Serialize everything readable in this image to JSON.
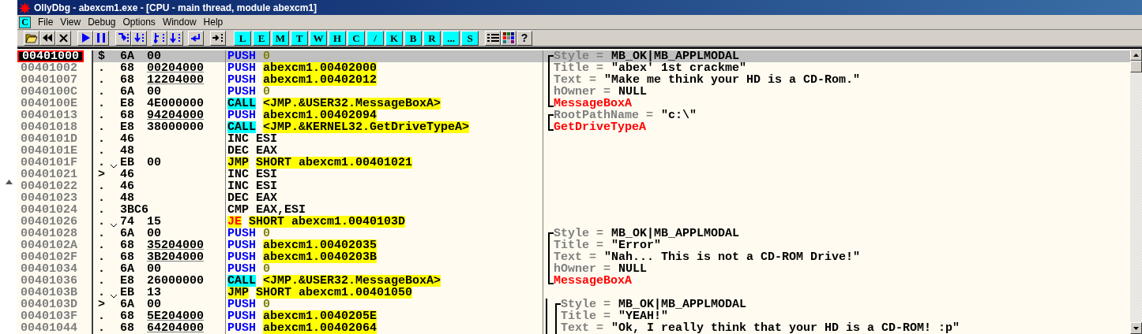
{
  "window": {
    "title": "OllyDbg - abexcm1.exe - [CPU - main thread, module abexcm1]"
  },
  "menu": {
    "badge": "C",
    "items": [
      "File",
      "View",
      "Debug",
      "Options",
      "Window",
      "Help"
    ]
  },
  "toolbar": {
    "icon_buttons": [
      {
        "kind": "open"
      },
      {
        "kind": "restart"
      },
      {
        "kind": "close"
      },
      {
        "kind": "run"
      },
      {
        "kind": "pause"
      },
      {
        "kind": "step_into"
      },
      {
        "kind": "step_over"
      },
      {
        "kind": "trace_into"
      },
      {
        "kind": "trace_over"
      },
      {
        "kind": "till_return"
      },
      {
        "kind": "goto"
      }
    ],
    "letter_buttons": [
      "L",
      "E",
      "M",
      "T",
      "W",
      "H",
      "C",
      "/",
      "K",
      "B",
      "R",
      "...",
      "S"
    ],
    "end_buttons": [
      {
        "kind": "list"
      },
      {
        "kind": "colors"
      },
      {
        "kind": "text",
        "text": "?"
      }
    ]
  },
  "disassembly": {
    "rows": [
      {
        "address": "00401000",
        "selected": true,
        "marker": "$",
        "jump": false,
        "opcode": "6A",
        "operand_bytes": "00",
        "fixup": false,
        "instruction": [
          {
            "kind": "push",
            "text": "PUSH"
          },
          {
            "kind": "const",
            "text": "0"
          }
        ],
        "comment": {
          "kind": "param",
          "bracket_top": true,
          "bracket_bottom": false,
          "nested": false,
          "name": "Style =",
          "value": "MB_OK|MB_APPLMODAL"
        }
      },
      {
        "address": "00401002",
        "selected": false,
        "marker": ".",
        "jump": false,
        "opcode": "68",
        "operand_bytes": "00204000",
        "fixup": true,
        "instruction": [
          {
            "kind": "push",
            "text": "PUSH"
          },
          {
            "kind": "highlight",
            "text": "abexcm1.00402000"
          }
        ],
        "comment": {
          "kind": "param",
          "bracket_top": false,
          "bracket_bottom": false,
          "nested": false,
          "name": "Title =",
          "value": "\"abex' 1st crackme\""
        }
      },
      {
        "address": "00401007",
        "selected": false,
        "marker": ".",
        "jump": false,
        "opcode": "68",
        "operand_bytes": "12204000",
        "fixup": true,
        "instruction": [
          {
            "kind": "push",
            "text": "PUSH"
          },
          {
            "kind": "highlight",
            "text": "abexcm1.00402012"
          }
        ],
        "comment": {
          "kind": "param",
          "bracket_top": false,
          "bracket_bottom": false,
          "nested": false,
          "name": "Text =",
          "value": "\"Make me think your HD is a CD-Rom.\""
        }
      },
      {
        "address": "0040100C",
        "selected": false,
        "marker": ".",
        "jump": false,
        "opcode": "6A",
        "operand_bytes": "00",
        "fixup": false,
        "instruction": [
          {
            "kind": "push",
            "text": "PUSH"
          },
          {
            "kind": "const",
            "text": "0"
          }
        ],
        "comment": {
          "kind": "param",
          "bracket_top": false,
          "bracket_bottom": false,
          "nested": false,
          "name": "hOwner =",
          "value": "NULL"
        }
      },
      {
        "address": "0040100E",
        "selected": false,
        "marker": ".",
        "jump": false,
        "opcode": "E8",
        "operand_bytes": "4E000000",
        "fixup": false,
        "instruction": [
          {
            "kind": "call",
            "text": "CALL"
          },
          {
            "kind": "highlight",
            "text": "<JMP.&USER32.MessageBoxA>"
          }
        ],
        "comment": {
          "kind": "function",
          "bracket_top": false,
          "bracket_bottom": true,
          "nested": false,
          "name": "MessageBoxA"
        }
      },
      {
        "address": "00401013",
        "selected": false,
        "marker": ".",
        "jump": false,
        "opcode": "68",
        "operand_bytes": "94204000",
        "fixup": true,
        "instruction": [
          {
            "kind": "push",
            "text": "PUSH"
          },
          {
            "kind": "highlight",
            "text": "abexcm1.00402094"
          }
        ],
        "comment": {
          "kind": "param",
          "bracket_top": true,
          "bracket_bottom": false,
          "nested": false,
          "name": "RootPathName =",
          "value": "\"c:\\\""
        }
      },
      {
        "address": "00401018",
        "selected": false,
        "marker": ".",
        "jump": false,
        "opcode": "E8",
        "operand_bytes": "38000000",
        "fixup": false,
        "instruction": [
          {
            "kind": "call",
            "text": "CALL"
          },
          {
            "kind": "highlight",
            "text": "<JMP.&KERNEL32.GetDriveTypeA>"
          }
        ],
        "comment": {
          "kind": "function",
          "bracket_top": false,
          "bracket_bottom": true,
          "nested": false,
          "name": "GetDriveTypeA"
        }
      },
      {
        "address": "0040101D",
        "selected": false,
        "marker": ".",
        "jump": false,
        "opcode": "46",
        "instruction": [
          {
            "kind": "plain",
            "text": "INC"
          },
          {
            "kind": "plain",
            "text": "ESI"
          }
        ]
      },
      {
        "address": "0040101E",
        "selected": false,
        "marker": ".",
        "jump": false,
        "opcode": "48",
        "instruction": [
          {
            "kind": "plain",
            "text": "DEC"
          },
          {
            "kind": "plain",
            "text": "EAX"
          }
        ]
      },
      {
        "address": "0040101F",
        "selected": false,
        "marker": ".",
        "jump": true,
        "opcode": "EB",
        "operand_bytes": "00",
        "fixup": false,
        "instruction": [
          {
            "kind": "jmp",
            "text": "JMP"
          },
          {
            "kind": "highlight",
            "text": "SHORT abexcm1.00401021"
          }
        ]
      },
      {
        "address": "00401021",
        "selected": false,
        "marker": ">",
        "jump": false,
        "opcode": "46",
        "instruction": [
          {
            "kind": "plain",
            "text": "INC"
          },
          {
            "kind": "plain",
            "text": "ESI"
          }
        ]
      },
      {
        "address": "00401022",
        "selected": false,
        "marker": ".",
        "jump": false,
        "opcode": "46",
        "instruction": [
          {
            "kind": "plain",
            "text": "INC"
          },
          {
            "kind": "plain",
            "text": "ESI"
          }
        ]
      },
      {
        "address": "00401023",
        "selected": false,
        "marker": ".",
        "jump": false,
        "opcode": "48",
        "instruction": [
          {
            "kind": "plain",
            "text": "DEC"
          },
          {
            "kind": "plain",
            "text": "EAX"
          }
        ]
      },
      {
        "address": "00401024",
        "selected": false,
        "marker": ".",
        "jump": false,
        "opcode": "3BC6",
        "instruction": [
          {
            "kind": "plain",
            "text": "CMP"
          },
          {
            "kind": "plain",
            "text": "EAX,ESI"
          }
        ]
      },
      {
        "address": "00401026",
        "selected": false,
        "marker": ".",
        "jump": true,
        "opcode": "74",
        "operand_bytes": "15",
        "fixup": false,
        "instruction": [
          {
            "kind": "jcc",
            "text": "JE"
          },
          {
            "kind": "highlight",
            "text": "SHORT abexcm1.0040103D"
          }
        ]
      },
      {
        "address": "00401028",
        "selected": false,
        "marker": ".",
        "jump": false,
        "opcode": "6A",
        "operand_bytes": "00",
        "fixup": false,
        "instruction": [
          {
            "kind": "push",
            "text": "PUSH"
          },
          {
            "kind": "const",
            "text": "0"
          }
        ],
        "comment": {
          "kind": "param",
          "bracket_top": true,
          "bracket_bottom": false,
          "nested": false,
          "name": "Style =",
          "value": "MB_OK|MB_APPLMODAL"
        }
      },
      {
        "address": "0040102A",
        "selected": false,
        "marker": ".",
        "jump": false,
        "opcode": "68",
        "operand_bytes": "35204000",
        "fixup": true,
        "instruction": [
          {
            "kind": "push",
            "text": "PUSH"
          },
          {
            "kind": "highlight",
            "text": "abexcm1.00402035"
          }
        ],
        "comment": {
          "kind": "param",
          "bracket_top": false,
          "bracket_bottom": false,
          "nested": false,
          "name": "Title =",
          "value": "\"Error\""
        }
      },
      {
        "address": "0040102F",
        "selected": false,
        "marker": ".",
        "jump": false,
        "opcode": "68",
        "operand_bytes": "3B204000",
        "fixup": true,
        "instruction": [
          {
            "kind": "push",
            "text": "PUSH"
          },
          {
            "kind": "highlight",
            "text": "abexcm1.0040203B"
          }
        ],
        "comment": {
          "kind": "param",
          "bracket_top": false,
          "bracket_bottom": false,
          "nested": false,
          "name": "Text =",
          "value": "\"Nah... This is not a CD-ROM Drive!\""
        }
      },
      {
        "address": "00401034",
        "selected": false,
        "marker": ".",
        "jump": false,
        "opcode": "6A",
        "operand_bytes": "00",
        "fixup": false,
        "instruction": [
          {
            "kind": "push",
            "text": "PUSH"
          },
          {
            "kind": "const",
            "text": "0"
          }
        ],
        "comment": {
          "kind": "param",
          "bracket_top": false,
          "bracket_bottom": false,
          "nested": false,
          "name": "hOwner =",
          "value": "NULL"
        }
      },
      {
        "address": "00401036",
        "selected": false,
        "marker": ".",
        "jump": false,
        "opcode": "E8",
        "operand_bytes": "26000000",
        "fixup": false,
        "instruction": [
          {
            "kind": "call",
            "text": "CALL"
          },
          {
            "kind": "highlight",
            "text": "<JMP.&USER32.MessageBoxA>"
          }
        ],
        "comment": {
          "kind": "function",
          "bracket_top": false,
          "bracket_bottom": true,
          "nested": false,
          "name": "MessageBoxA"
        }
      },
      {
        "address": "0040103B",
        "selected": false,
        "marker": ".",
        "jump": true,
        "opcode": "EB",
        "operand_bytes": "13",
        "fixup": false,
        "instruction": [
          {
            "kind": "jmp",
            "text": "JMP"
          },
          {
            "kind": "highlight",
            "text": "SHORT abexcm1.00401050"
          }
        ]
      },
      {
        "address": "0040103D",
        "selected": false,
        "marker": ">",
        "jump": false,
        "opcode": "6A",
        "operand_bytes": "00",
        "fixup": false,
        "instruction": [
          {
            "kind": "push",
            "text": "PUSH"
          },
          {
            "kind": "const",
            "text": "0"
          }
        ],
        "comment": {
          "kind": "param",
          "bracket_top": true,
          "bracket_bottom": false,
          "nested": true,
          "name": "Style =",
          "value": "MB_OK|MB_APPLMODAL"
        }
      },
      {
        "address": "0040103F",
        "selected": false,
        "marker": ".",
        "jump": false,
        "opcode": "68",
        "operand_bytes": "5E204000",
        "fixup": true,
        "instruction": [
          {
            "kind": "push",
            "text": "PUSH"
          },
          {
            "kind": "highlight",
            "text": "abexcm1.0040205E"
          }
        ],
        "comment": {
          "kind": "param",
          "bracket_top": false,
          "bracket_bottom": false,
          "nested": true,
          "name": "Title =",
          "value": "\"YEAH!\""
        }
      },
      {
        "address": "00401044",
        "selected": false,
        "marker": ".",
        "jump": false,
        "opcode": "68",
        "operand_bytes": "64204000",
        "fixup": true,
        "instruction": [
          {
            "kind": "push",
            "text": "PUSH"
          },
          {
            "kind": "highlight",
            "text": "abexcm1.00402064"
          }
        ],
        "comment": {
          "kind": "param",
          "bracket_top": false,
          "bracket_bottom": false,
          "nested": true,
          "name": "Text =",
          "value": "\"Ok, I really think that your HD is a CD-ROM! :p\""
        }
      }
    ]
  }
}
